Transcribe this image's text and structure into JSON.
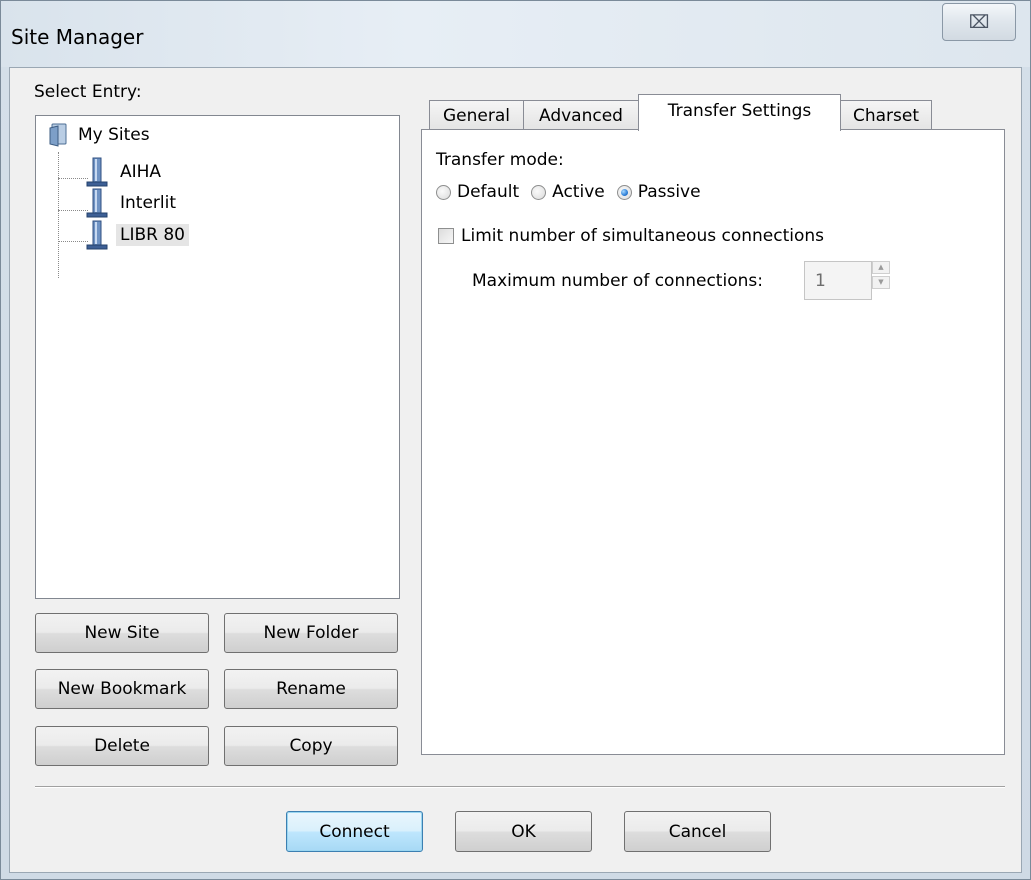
{
  "window": {
    "title": "Site Manager",
    "close_glyph": "⌧"
  },
  "left": {
    "select_label": "Select Entry:",
    "tree": {
      "root": "My Sites",
      "items": [
        {
          "label": "AIHA",
          "selected": false
        },
        {
          "label": "Interlit",
          "selected": false
        },
        {
          "label": "LIBR 80",
          "selected": true
        }
      ]
    },
    "buttons": {
      "new_site": "New Site",
      "new_folder": "New Folder",
      "new_bookmark": "New Bookmark",
      "rename": "Rename",
      "delete": "Delete",
      "copy": "Copy"
    }
  },
  "tabs": [
    {
      "label": "General",
      "active": false
    },
    {
      "label": "Advanced",
      "active": false
    },
    {
      "label": "Transfer Settings",
      "active": true
    },
    {
      "label": "Charset",
      "active": false
    }
  ],
  "transfer": {
    "mode_label": "Transfer mode:",
    "modes": [
      {
        "label": "Default",
        "checked": false
      },
      {
        "label": "Active",
        "checked": false
      },
      {
        "label": "Passive",
        "checked": true
      }
    ],
    "limit_label": "Limit number of simultaneous connections",
    "limit_checked": false,
    "max_label": "Maximum number of connections:",
    "max_value": "1",
    "spin_up": "▲",
    "spin_down": "▼"
  },
  "footer": {
    "connect": "Connect",
    "ok": "OK",
    "cancel": "Cancel"
  }
}
